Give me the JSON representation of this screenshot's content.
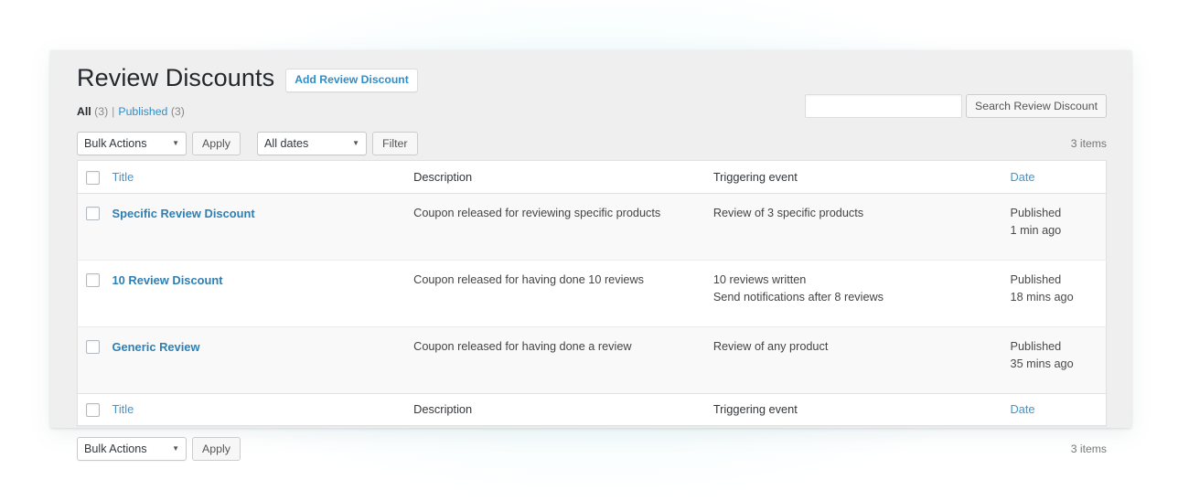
{
  "page": {
    "title": "Review Discounts",
    "add_new_label": "Add Review Discount"
  },
  "views": {
    "all_label": "All",
    "all_count": "(3)",
    "separator": "|",
    "published_label": "Published",
    "published_count": "(3)"
  },
  "search": {
    "value": "",
    "placeholder": "",
    "submit_label": "Search Review Discount"
  },
  "tablenav_top": {
    "bulk_actions_label": "Bulk Actions",
    "apply_label": "Apply",
    "dates_label": "All dates",
    "filter_label": "Filter",
    "displaying_num": "3 items"
  },
  "tablenav_bottom": {
    "bulk_actions_label": "Bulk Actions",
    "apply_label": "Apply",
    "displaying_num": "3 items"
  },
  "table": {
    "columns": {
      "title": "Title",
      "description": "Description",
      "triggering_event": "Triggering event",
      "date": "Date"
    },
    "rows": [
      {
        "title": "Specific Review Discount",
        "description": "Coupon released for reviewing specific products",
        "trigger_line1": "Review of 3 specific products",
        "trigger_line2": "",
        "date_status": "Published",
        "date_relative": "1 min ago"
      },
      {
        "title": "10 Review Discount",
        "description": "Coupon released for having done 10 reviews",
        "trigger_line1": "10 reviews written",
        "trigger_line2": "Send notifications after 8 reviews",
        "date_status": "Published",
        "date_relative": "18 mins ago"
      },
      {
        "title": "Generic Review",
        "description": "Coupon released for having done a review",
        "trigger_line1": "Review of any product",
        "trigger_line2": "",
        "date_status": "Published",
        "date_relative": "35 mins ago"
      }
    ]
  },
  "icons": {
    "dropdown_arrow": "▼"
  },
  "colors": {
    "link_blue": "#2e8ecb",
    "row_title_blue": "#2e7fb4",
    "panel_bg": "#efefef",
    "glow": "#e2f4f8"
  }
}
